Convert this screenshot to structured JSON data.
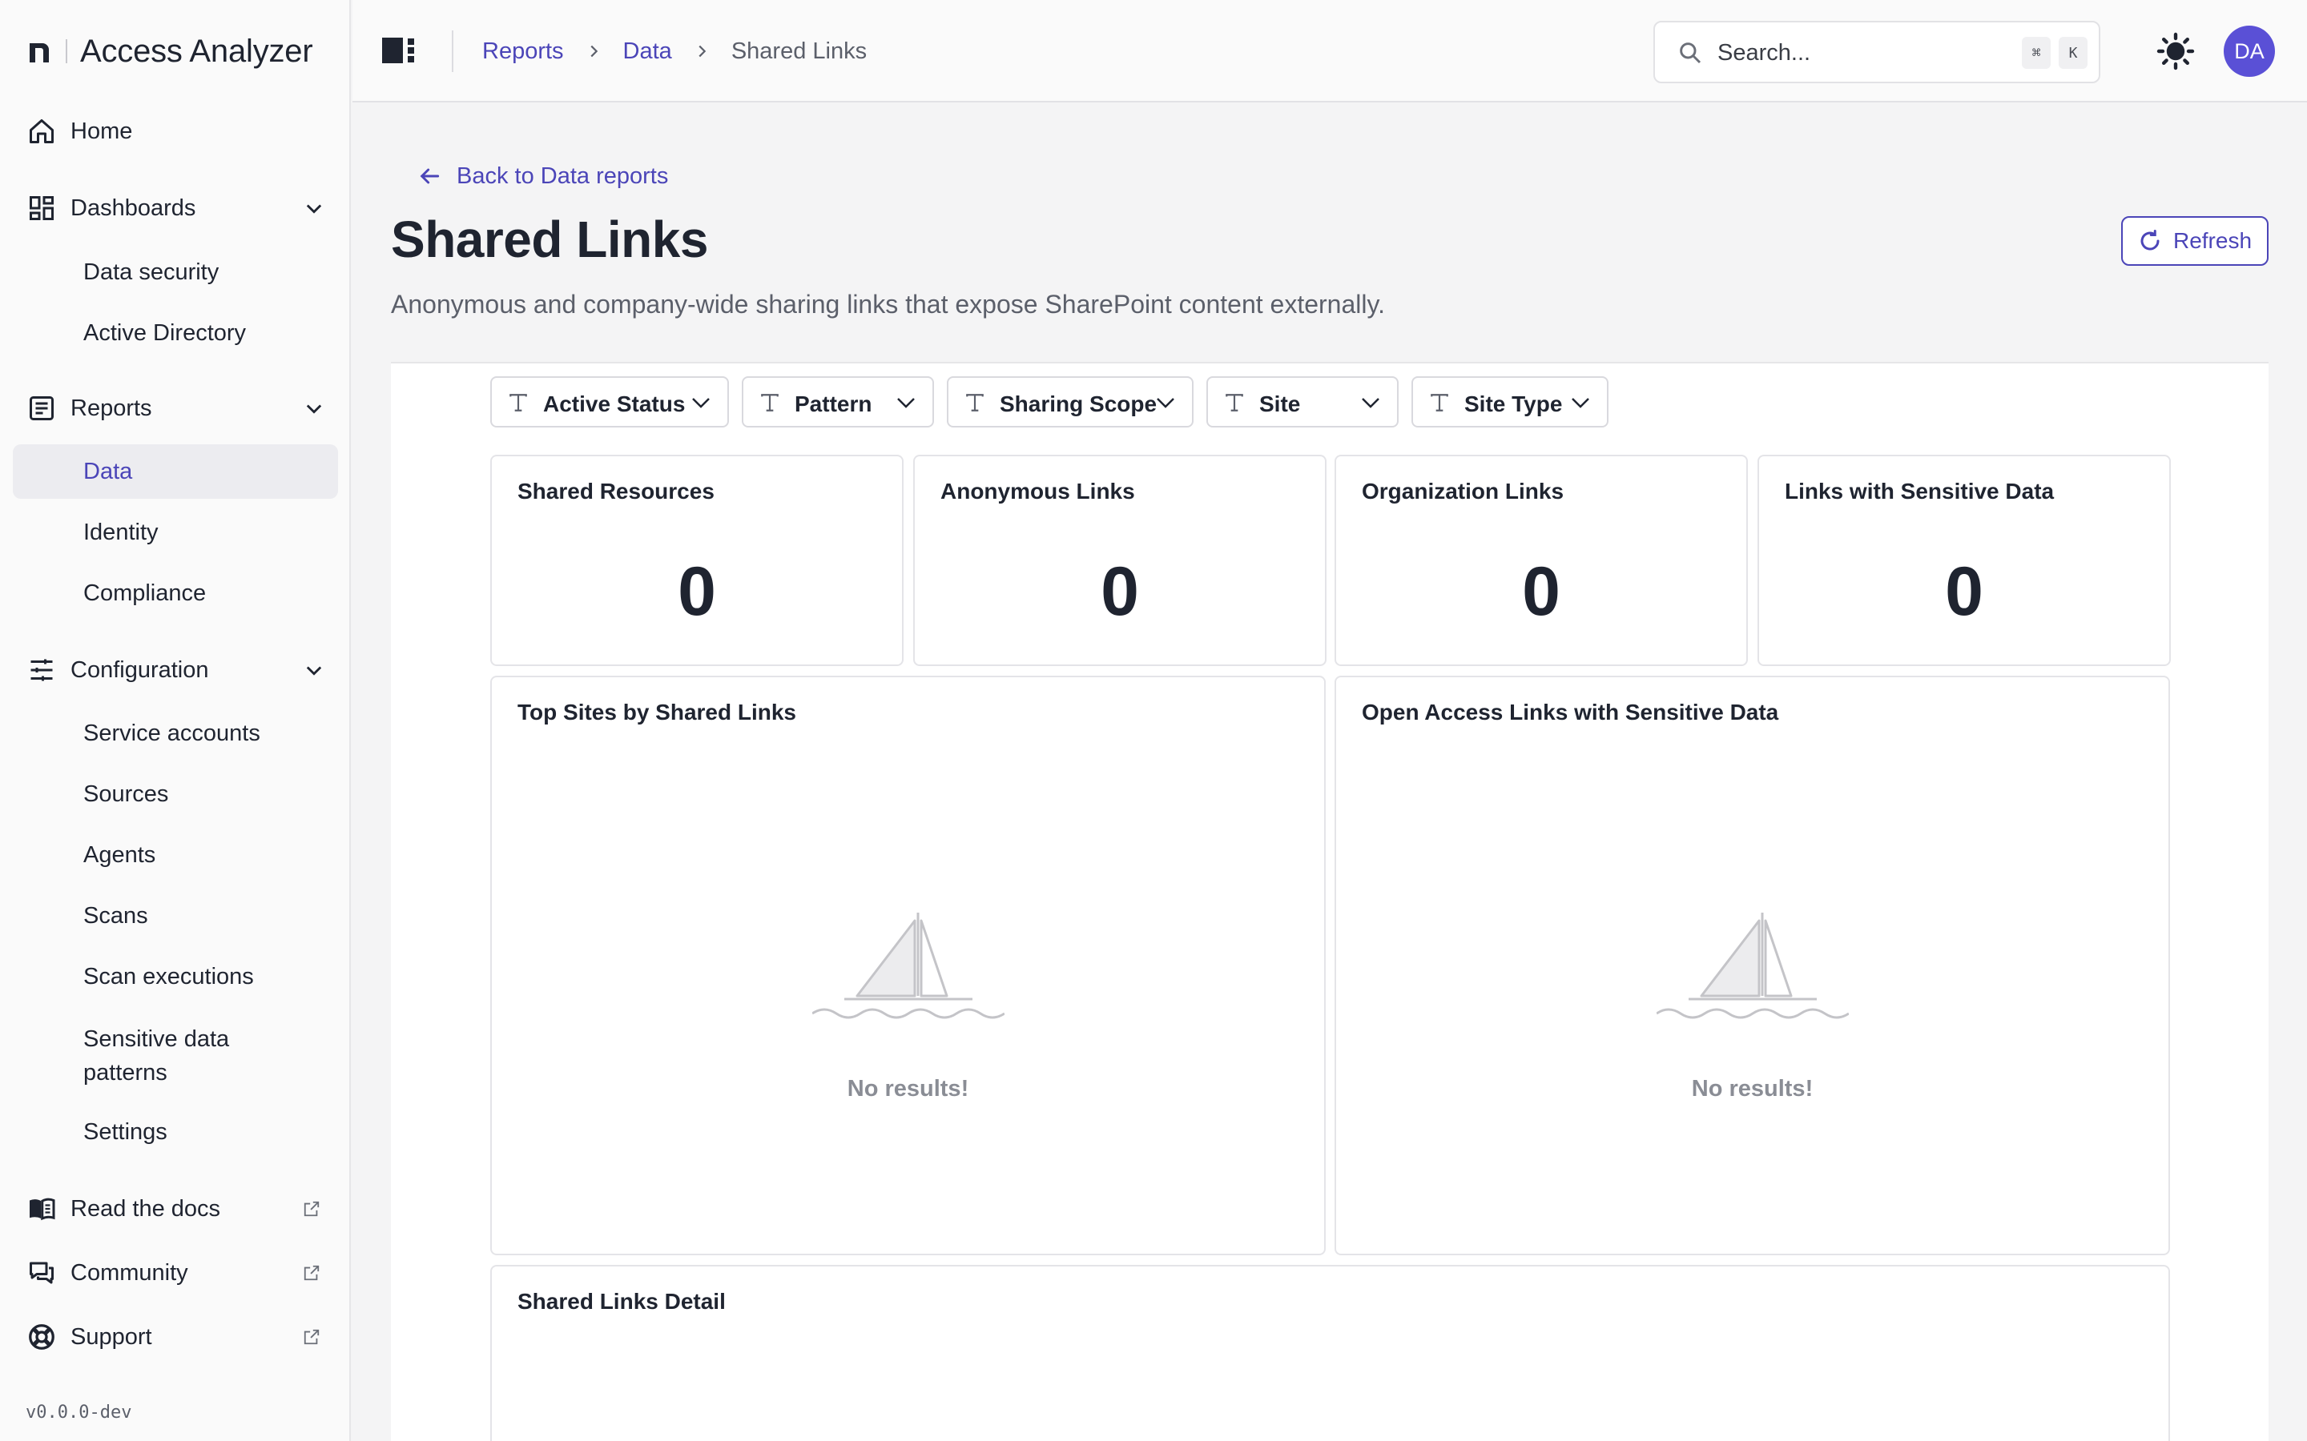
{
  "app": {
    "name": "Access Analyzer",
    "version": "v0.0.0-dev"
  },
  "sidebar": {
    "home": "Home",
    "dashboards": {
      "label": "Dashboards",
      "items": [
        "Data security",
        "Active Directory"
      ]
    },
    "reports": {
      "label": "Reports",
      "items": [
        "Data",
        "Identity",
        "Compliance"
      ],
      "active": "Data"
    },
    "configuration": {
      "label": "Configuration",
      "items": [
        "Service accounts",
        "Sources",
        "Agents",
        "Scans",
        "Scan executions",
        "Sensitive data patterns",
        "Settings"
      ]
    },
    "footer": [
      "Read the docs",
      "Community",
      "Support"
    ]
  },
  "topbar": {
    "breadcrumbs": [
      "Reports",
      "Data",
      "Shared Links"
    ],
    "search_placeholder": "Search...",
    "shortcut": [
      "⌘",
      "K"
    ],
    "avatar": "DA"
  },
  "page": {
    "back": "Back to Data reports",
    "title": "Shared Links",
    "description": "Anonymous and company-wide sharing links that expose SharePoint content externally.",
    "refresh": "Refresh"
  },
  "filters": [
    "Active Status",
    "Pattern",
    "Sharing Scope",
    "Site",
    "Site Type"
  ],
  "metrics": [
    {
      "title": "Shared Resources",
      "value": "0"
    },
    {
      "title": "Anonymous Links",
      "value": "0"
    },
    {
      "title": "Organization Links",
      "value": "0"
    },
    {
      "title": "Links with Sensitive Data",
      "value": "0"
    }
  ],
  "panels": [
    {
      "title": "Top Sites by Shared Links",
      "empty": "No results!"
    },
    {
      "title": "Open Access Links with Sensitive Data",
      "empty": "No results!"
    }
  ],
  "detail": {
    "title": "Shared Links Detail"
  },
  "colors": {
    "accent": "#4b45b8",
    "avatar": "#5a50d6",
    "text": "#1f2430",
    "muted": "#5b5f6a"
  }
}
